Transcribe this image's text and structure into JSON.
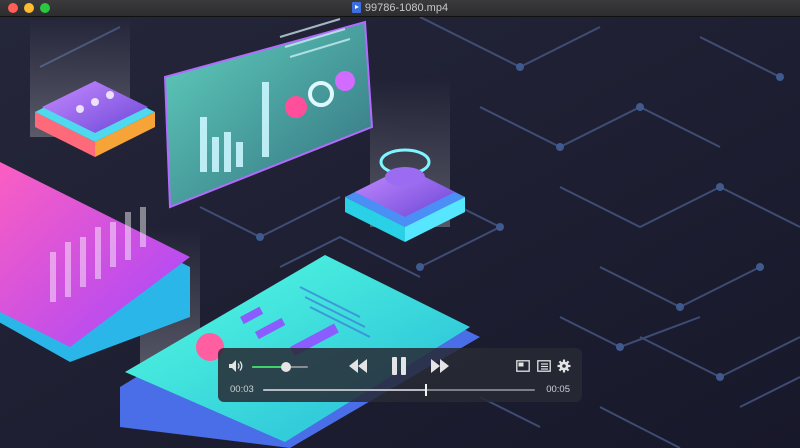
{
  "window": {
    "title": "99786-1080.mp4",
    "traffic_lights": {
      "close": "#ff5f57",
      "minimize": "#febc2e",
      "maximize": "#28c840"
    }
  },
  "player": {
    "state": "playing",
    "volume_fraction": 0.6,
    "playback_fraction": 0.6,
    "current_time": "00:03",
    "duration": "00:05",
    "accent_color": "#3fd46a",
    "icons": [
      "volume-icon",
      "rewind-icon",
      "pause-icon",
      "fast-forward-icon",
      "picture-in-picture-icon",
      "playlist-icon",
      "gear-icon"
    ]
  }
}
